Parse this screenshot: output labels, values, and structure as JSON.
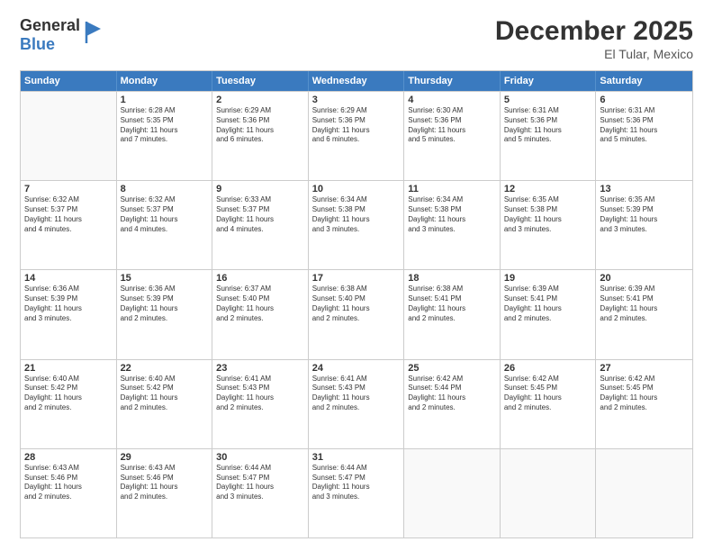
{
  "logo": {
    "general": "General",
    "blue": "Blue"
  },
  "title": "December 2025",
  "location": "El Tular, Mexico",
  "days_of_week": [
    "Sunday",
    "Monday",
    "Tuesday",
    "Wednesday",
    "Thursday",
    "Friday",
    "Saturday"
  ],
  "weeks": [
    [
      {
        "day": "",
        "empty": true,
        "info": ""
      },
      {
        "day": "1",
        "info": "Sunrise: 6:28 AM\nSunset: 5:35 PM\nDaylight: 11 hours\nand 7 minutes."
      },
      {
        "day": "2",
        "info": "Sunrise: 6:29 AM\nSunset: 5:36 PM\nDaylight: 11 hours\nand 6 minutes."
      },
      {
        "day": "3",
        "info": "Sunrise: 6:29 AM\nSunset: 5:36 PM\nDaylight: 11 hours\nand 6 minutes."
      },
      {
        "day": "4",
        "info": "Sunrise: 6:30 AM\nSunset: 5:36 PM\nDaylight: 11 hours\nand 5 minutes."
      },
      {
        "day": "5",
        "info": "Sunrise: 6:31 AM\nSunset: 5:36 PM\nDaylight: 11 hours\nand 5 minutes."
      },
      {
        "day": "6",
        "info": "Sunrise: 6:31 AM\nSunset: 5:36 PM\nDaylight: 11 hours\nand 5 minutes."
      }
    ],
    [
      {
        "day": "7",
        "info": "Sunrise: 6:32 AM\nSunset: 5:37 PM\nDaylight: 11 hours\nand 4 minutes."
      },
      {
        "day": "8",
        "info": "Sunrise: 6:32 AM\nSunset: 5:37 PM\nDaylight: 11 hours\nand 4 minutes."
      },
      {
        "day": "9",
        "info": "Sunrise: 6:33 AM\nSunset: 5:37 PM\nDaylight: 11 hours\nand 4 minutes."
      },
      {
        "day": "10",
        "info": "Sunrise: 6:34 AM\nSunset: 5:38 PM\nDaylight: 11 hours\nand 3 minutes."
      },
      {
        "day": "11",
        "info": "Sunrise: 6:34 AM\nSunset: 5:38 PM\nDaylight: 11 hours\nand 3 minutes."
      },
      {
        "day": "12",
        "info": "Sunrise: 6:35 AM\nSunset: 5:38 PM\nDaylight: 11 hours\nand 3 minutes."
      },
      {
        "day": "13",
        "info": "Sunrise: 6:35 AM\nSunset: 5:39 PM\nDaylight: 11 hours\nand 3 minutes."
      }
    ],
    [
      {
        "day": "14",
        "info": "Sunrise: 6:36 AM\nSunset: 5:39 PM\nDaylight: 11 hours\nand 3 minutes."
      },
      {
        "day": "15",
        "info": "Sunrise: 6:36 AM\nSunset: 5:39 PM\nDaylight: 11 hours\nand 2 minutes."
      },
      {
        "day": "16",
        "info": "Sunrise: 6:37 AM\nSunset: 5:40 PM\nDaylight: 11 hours\nand 2 minutes."
      },
      {
        "day": "17",
        "info": "Sunrise: 6:38 AM\nSunset: 5:40 PM\nDaylight: 11 hours\nand 2 minutes."
      },
      {
        "day": "18",
        "info": "Sunrise: 6:38 AM\nSunset: 5:41 PM\nDaylight: 11 hours\nand 2 minutes."
      },
      {
        "day": "19",
        "info": "Sunrise: 6:39 AM\nSunset: 5:41 PM\nDaylight: 11 hours\nand 2 minutes."
      },
      {
        "day": "20",
        "info": "Sunrise: 6:39 AM\nSunset: 5:41 PM\nDaylight: 11 hours\nand 2 minutes."
      }
    ],
    [
      {
        "day": "21",
        "info": "Sunrise: 6:40 AM\nSunset: 5:42 PM\nDaylight: 11 hours\nand 2 minutes."
      },
      {
        "day": "22",
        "info": "Sunrise: 6:40 AM\nSunset: 5:42 PM\nDaylight: 11 hours\nand 2 minutes."
      },
      {
        "day": "23",
        "info": "Sunrise: 6:41 AM\nSunset: 5:43 PM\nDaylight: 11 hours\nand 2 minutes."
      },
      {
        "day": "24",
        "info": "Sunrise: 6:41 AM\nSunset: 5:43 PM\nDaylight: 11 hours\nand 2 minutes."
      },
      {
        "day": "25",
        "info": "Sunrise: 6:42 AM\nSunset: 5:44 PM\nDaylight: 11 hours\nand 2 minutes."
      },
      {
        "day": "26",
        "info": "Sunrise: 6:42 AM\nSunset: 5:45 PM\nDaylight: 11 hours\nand 2 minutes."
      },
      {
        "day": "27",
        "info": "Sunrise: 6:42 AM\nSunset: 5:45 PM\nDaylight: 11 hours\nand 2 minutes."
      }
    ],
    [
      {
        "day": "28",
        "info": "Sunrise: 6:43 AM\nSunset: 5:46 PM\nDaylight: 11 hours\nand 2 minutes."
      },
      {
        "day": "29",
        "info": "Sunrise: 6:43 AM\nSunset: 5:46 PM\nDaylight: 11 hours\nand 2 minutes."
      },
      {
        "day": "30",
        "info": "Sunrise: 6:44 AM\nSunset: 5:47 PM\nDaylight: 11 hours\nand 3 minutes."
      },
      {
        "day": "31",
        "info": "Sunrise: 6:44 AM\nSunset: 5:47 PM\nDaylight: 11 hours\nand 3 minutes."
      },
      {
        "day": "",
        "empty": true,
        "info": ""
      },
      {
        "day": "",
        "empty": true,
        "info": ""
      },
      {
        "day": "",
        "empty": true,
        "info": ""
      }
    ]
  ]
}
